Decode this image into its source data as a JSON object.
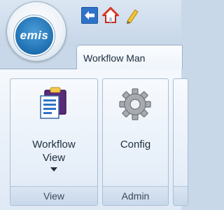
{
  "app": {
    "logo_text": "emis"
  },
  "quick_access": [
    {
      "icon": "back-arrow-icon"
    },
    {
      "icon": "home-icon"
    },
    {
      "icon": "pencil-icon"
    }
  ],
  "ribbon": {
    "active_tab": "Workflow Man",
    "groups": [
      {
        "label": "View",
        "buttons": [
          {
            "label_line1": "Workflow",
            "label_line2": "View",
            "icon": "workflow-view-icon",
            "has_dropdown": true
          }
        ]
      },
      {
        "label": "Admin",
        "buttons": [
          {
            "label": "Config",
            "icon": "gear-icon"
          }
        ]
      }
    ]
  },
  "colors": {
    "accent": "#1e6fb1",
    "ribbon_bg": "#e4edf8",
    "border": "#a9bdd4"
  }
}
